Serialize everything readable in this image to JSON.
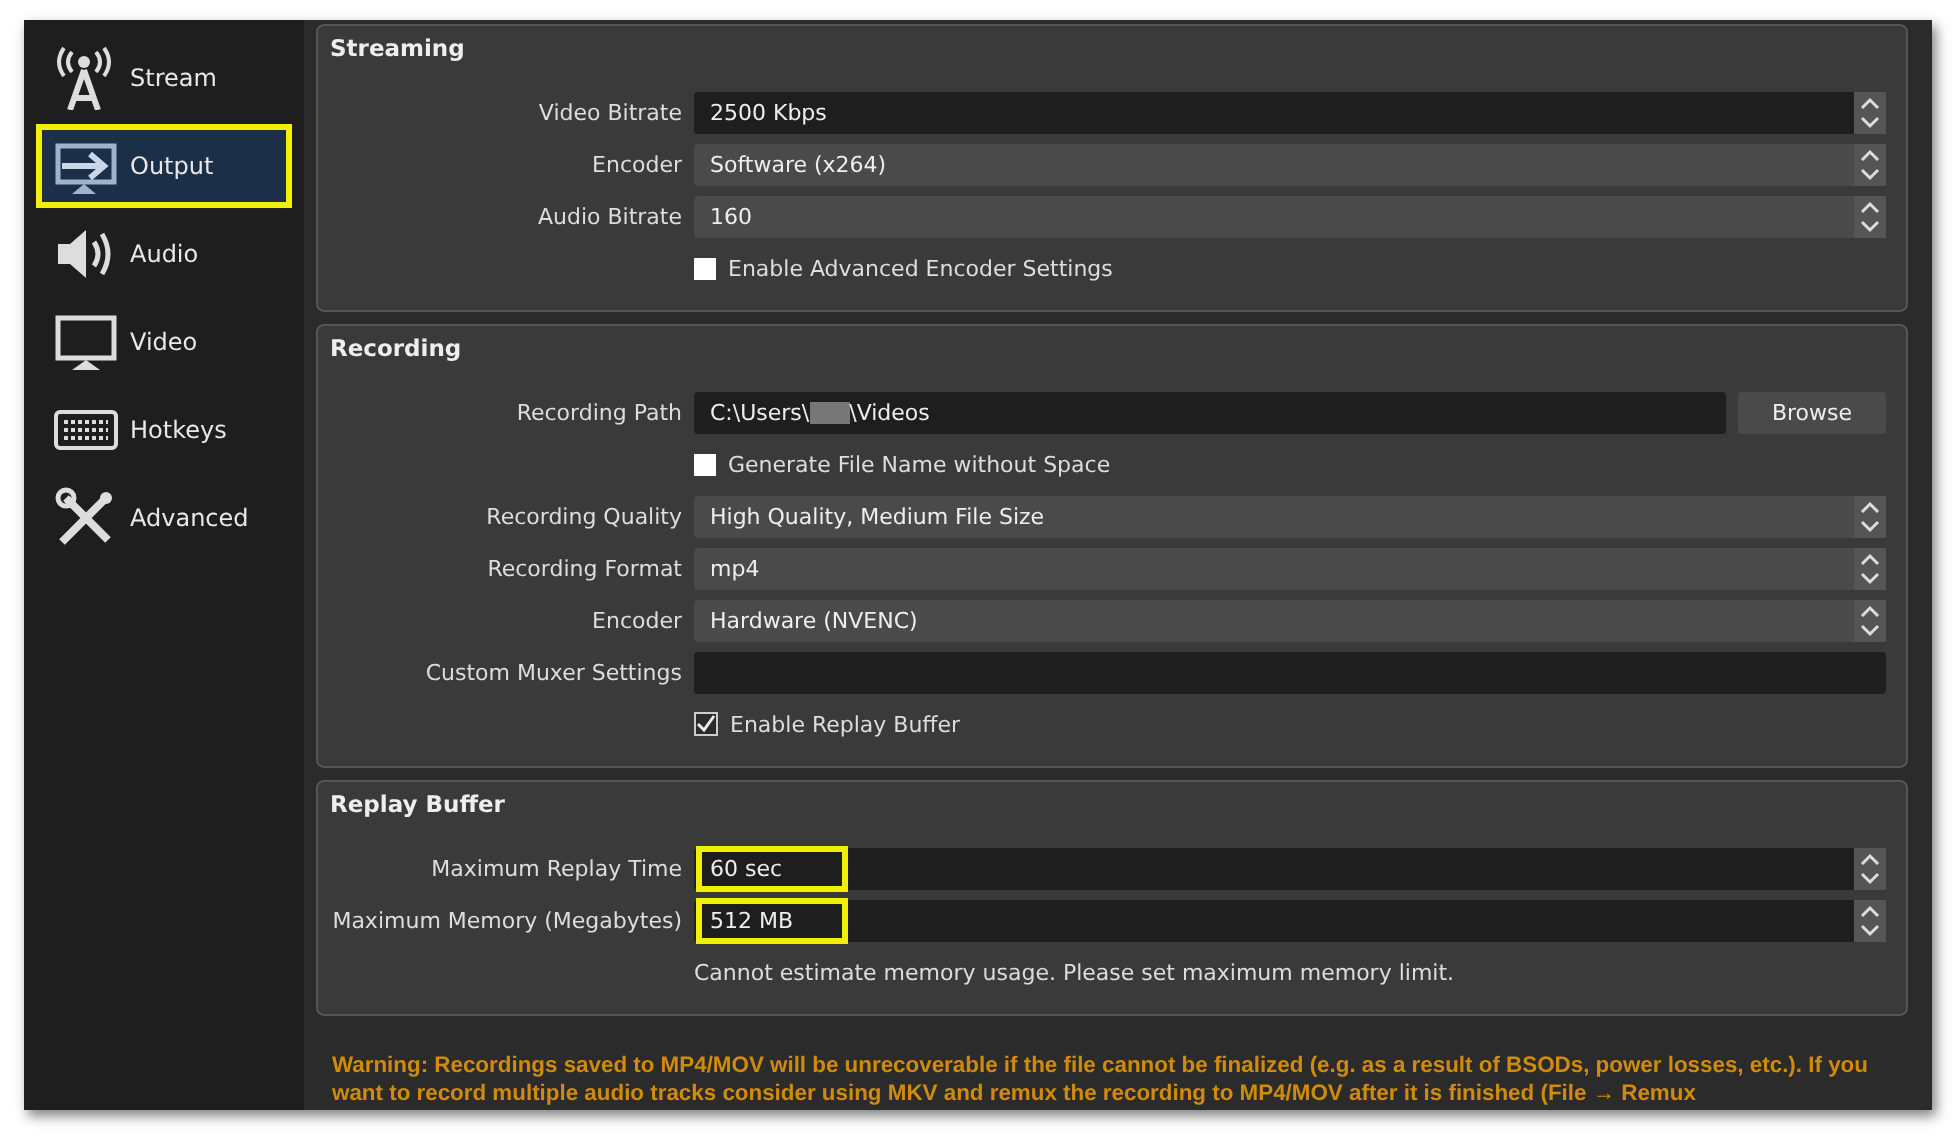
{
  "sidebar": {
    "items": [
      {
        "label": "Stream",
        "kind": "antenna",
        "selected": false,
        "highlighted": false
      },
      {
        "label": "Output",
        "kind": "output",
        "selected": true,
        "highlighted": true
      },
      {
        "label": "Audio",
        "kind": "speaker",
        "selected": false,
        "highlighted": false
      },
      {
        "label": "Video",
        "kind": "monitor",
        "selected": false,
        "highlighted": false
      },
      {
        "label": "Hotkeys",
        "kind": "keyboard",
        "selected": false,
        "highlighted": false
      },
      {
        "label": "Advanced",
        "kind": "tools",
        "selected": false,
        "highlighted": false
      }
    ]
  },
  "groups": [
    {
      "title": "Streaming",
      "rows": [
        {
          "kind": "spin",
          "label": "Video Bitrate",
          "value": "2500 Kbps",
          "highlighted": false
        },
        {
          "kind": "combo",
          "label": "Encoder",
          "value": "Software (x264)"
        },
        {
          "kind": "combo",
          "label": "Audio Bitrate",
          "value": "160"
        },
        {
          "kind": "checkbox",
          "label": "Enable Advanced Encoder Settings",
          "checked": false
        }
      ]
    },
    {
      "title": "Recording",
      "rows": [
        {
          "kind": "path",
          "label": "Recording Path",
          "value_start": "C:\\Users\\",
          "value_end": "\\Videos",
          "button": "Browse"
        },
        {
          "kind": "checkbox",
          "label": "Generate File Name without Space",
          "checked": false
        },
        {
          "kind": "combo",
          "label": "Recording Quality",
          "value": "High Quality, Medium File Size"
        },
        {
          "kind": "combo",
          "label": "Recording Format",
          "value": "mp4"
        },
        {
          "kind": "combo",
          "label": "Encoder",
          "value": "Hardware (NVENC)"
        },
        {
          "kind": "text",
          "label": "Custom Muxer Settings"
        },
        {
          "kind": "checkbox",
          "label": "Enable Replay Buffer",
          "checked": true
        }
      ]
    },
    {
      "title": "Replay Buffer",
      "rows": [
        {
          "kind": "spin",
          "label": "Maximum Replay Time",
          "value": "60 sec",
          "highlighted": true
        },
        {
          "kind": "spin",
          "label": "Maximum Memory (Megabytes)",
          "value": "512 MB",
          "highlighted": true
        },
        {
          "kind": "note",
          "text": "Cannot estimate memory usage. Please set maximum memory limit."
        }
      ]
    }
  ],
  "warning": "Warning: Recordings saved to MP4/MOV will be unrecoverable if the file cannot be finalized (e.g. as a result of BSODs, power losses, etc.). If you want to record multiple audio tracks consider using MKV and remux the recording to MP4/MOV after it is finished (File → Remux"
}
